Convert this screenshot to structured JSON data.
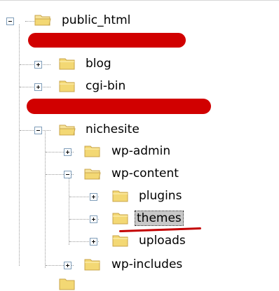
{
  "tree": {
    "root": {
      "label": "public_html",
      "state": "expanded"
    },
    "items": [
      {
        "id": "blog",
        "label": "blog",
        "state": "collapsed"
      },
      {
        "id": "cgi-bin",
        "label": "cgi-bin",
        "state": "collapsed"
      },
      {
        "id": "nichesite",
        "label": "nichesite",
        "state": "expanded"
      },
      {
        "id": "wp-admin",
        "label": "wp-admin",
        "state": "collapsed"
      },
      {
        "id": "wp-content",
        "label": "wp-content",
        "state": "expanded"
      },
      {
        "id": "plugins",
        "label": "plugins",
        "state": "collapsed"
      },
      {
        "id": "themes",
        "label": "themes",
        "state": "collapsed",
        "selected": true
      },
      {
        "id": "uploads",
        "label": "uploads",
        "state": "collapsed"
      },
      {
        "id": "wp-includes",
        "label": "wp-includes",
        "state": "collapsed"
      }
    ]
  },
  "colors": {
    "folder_body": "#f3d874",
    "folder_edge": "#c8a54a",
    "redaction": "#d10000",
    "selection": "#c8c8c8",
    "annotation": "#c30000"
  }
}
